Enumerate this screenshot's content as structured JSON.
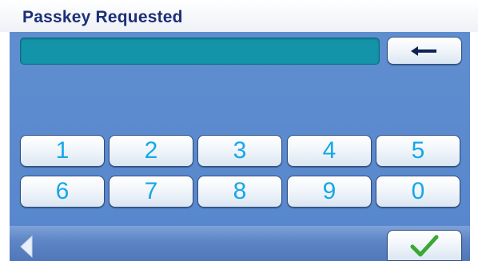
{
  "header": {
    "title": "Passkey Requested"
  },
  "display": {
    "value": ""
  },
  "keypad": {
    "keys": [
      "1",
      "2",
      "3",
      "4",
      "5",
      "6",
      "7",
      "8",
      "9",
      "0"
    ]
  },
  "icons": {
    "backspace": "left-arrow-icon",
    "back": "back-triangle-icon",
    "confirm": "checkmark-icon"
  },
  "colors": {
    "background": "#5887cd",
    "title": "#1c2f78",
    "display": "#1494a8",
    "key_digit": "#15a8e6",
    "checkmark": "#3aa832"
  }
}
